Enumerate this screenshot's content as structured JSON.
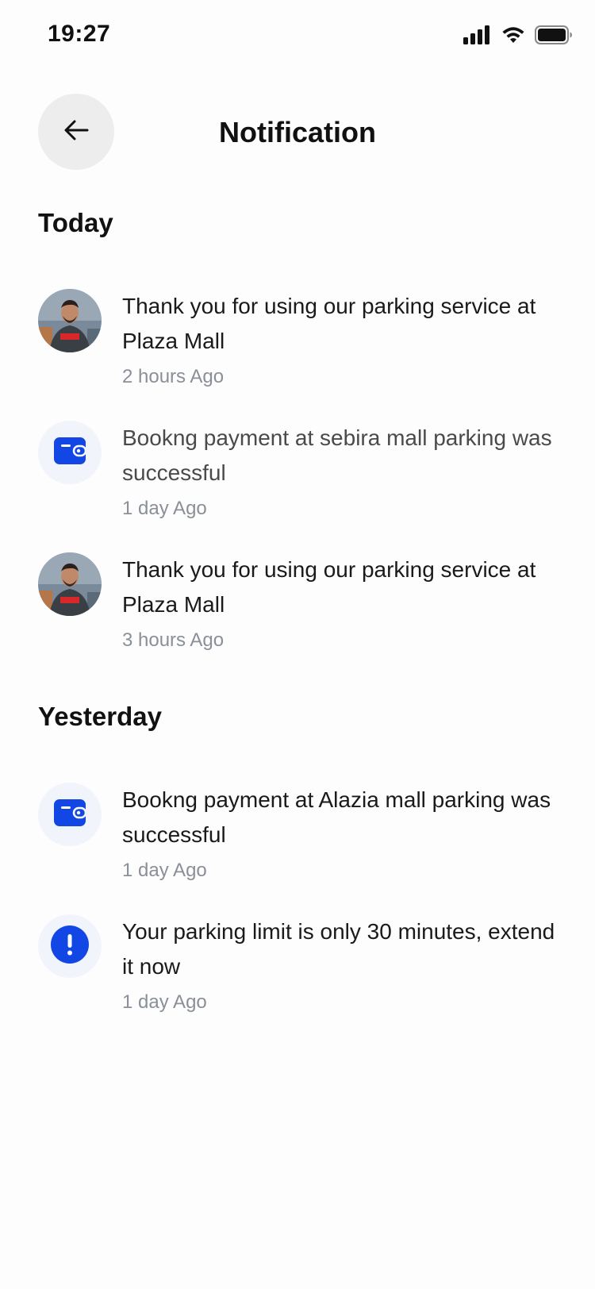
{
  "status_bar": {
    "time": "19:27",
    "icons": [
      "cellular-signal-icon",
      "wifi-icon",
      "battery-icon"
    ]
  },
  "header": {
    "title": "Notification",
    "back_icon": "arrow-left-icon"
  },
  "sections": {
    "today": {
      "title": "Today",
      "items": [
        {
          "icon": "avatar",
          "text": "Thank you for using our parking service at Plaza Mall",
          "time": "2 hours Ago"
        },
        {
          "icon": "wallet-icon",
          "text": "Bookng payment at sebira mall parking was successful",
          "time": "1 day Ago"
        },
        {
          "icon": "avatar",
          "text": "Thank you for using our parking service at Plaza Mall",
          "time": "3 hours Ago"
        }
      ]
    },
    "yesterday": {
      "title": "Yesterday",
      "items": [
        {
          "icon": "wallet-icon",
          "text": "Bookng payment at Alazia mall parking was successful",
          "time": "1 day Ago"
        },
        {
          "icon": "alert-icon",
          "text": "Your parking limit is only 30 minutes, extend it now",
          "time": "1 day Ago"
        }
      ]
    }
  },
  "colors": {
    "accent": "#1247e6",
    "icon_bg": "#f1f4fb",
    "back_button_bg": "#ededed",
    "muted_text": "#8a8f98"
  }
}
